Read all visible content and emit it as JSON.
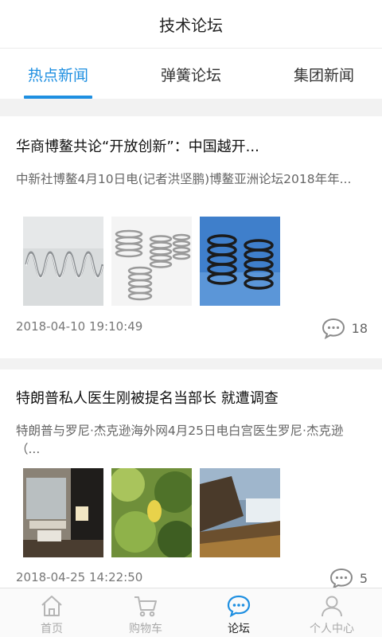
{
  "header": {
    "title": "技术论坛"
  },
  "tabs": [
    {
      "label": "热点新闻",
      "active": true
    },
    {
      "label": "弹簧论坛",
      "active": false
    },
    {
      "label": "集团新闻",
      "active": false
    }
  ],
  "colors": {
    "accent": "#1e8fe1",
    "background": "#ffffff",
    "divider": "#f2f2f2"
  },
  "news": [
    {
      "title": "华商博鳌共论“开放创新”：中国越开...",
      "summary": "中新社博鳌4月10日电(记者洪坚鹏)博鳌亚洲论坛2018年年...",
      "images": [
        "spring-photo",
        "spring-photo",
        "spring-photo"
      ],
      "date": "2018-04-10 19:10:49",
      "comments": "18"
    },
    {
      "title": "特朗普私人医生刚被提名当部长 就遭调查",
      "summary": "特朗普与罗尼·杰克逊海外网4月25日电白宫医生罗尼·杰克逊（...",
      "images": [
        "interior-photo",
        "leaves-photo",
        "waterfall-photo"
      ],
      "date": "2018-04-25 14:22:50",
      "comments": "5"
    }
  ],
  "bottom_nav": [
    {
      "label": "首页",
      "icon": "home-icon",
      "active": false
    },
    {
      "label": "购物车",
      "icon": "cart-icon",
      "active": false
    },
    {
      "label": "论坛",
      "icon": "forum-icon",
      "active": true
    },
    {
      "label": "个人中心",
      "icon": "user-icon",
      "active": false
    }
  ]
}
